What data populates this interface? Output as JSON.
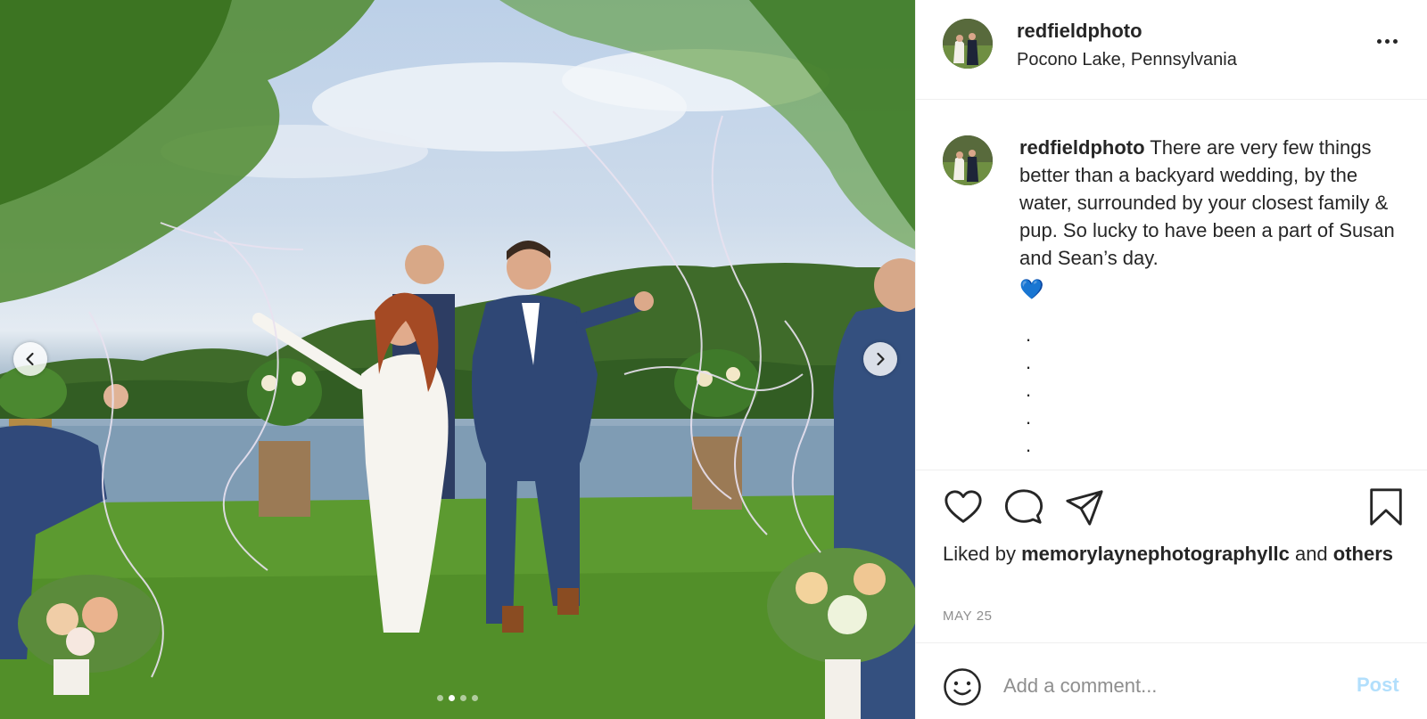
{
  "post": {
    "username": "redfieldphoto",
    "location": "Pocono Lake, Pennsylvania",
    "more_label": "More options",
    "photo_count": 4,
    "active_photo_index": 1
  },
  "caption": {
    "username": "redfieldphoto",
    "text": "There are very few things better than a backyard wedding, by the water, surrounded by your closest family & pup. So lucky to have been a part of Susan and Sean’s day.",
    "emoji": "💙",
    "bullets": [
      ".",
      ".",
      ".",
      ".",
      "."
    ]
  },
  "actions": {
    "like_icon": "heart-icon",
    "comment_icon": "comment-icon",
    "share_icon": "paper-plane-icon",
    "save_icon": "bookmark-icon"
  },
  "likes": {
    "prefix": "Liked by",
    "liker": "memorylaynephotographyllc",
    "conjunction": "and",
    "others": "others"
  },
  "date": "MAY 25",
  "comment": {
    "placeholder": "Add a comment...",
    "post_label": "Post",
    "emoji_icon": "smiley-icon"
  },
  "colors": {
    "text": "#262626",
    "muted": "#8e8e8e",
    "post_disabled": "#b2dffc",
    "divider": "#efefef",
    "heart_emoji": "#3f7fe6"
  }
}
